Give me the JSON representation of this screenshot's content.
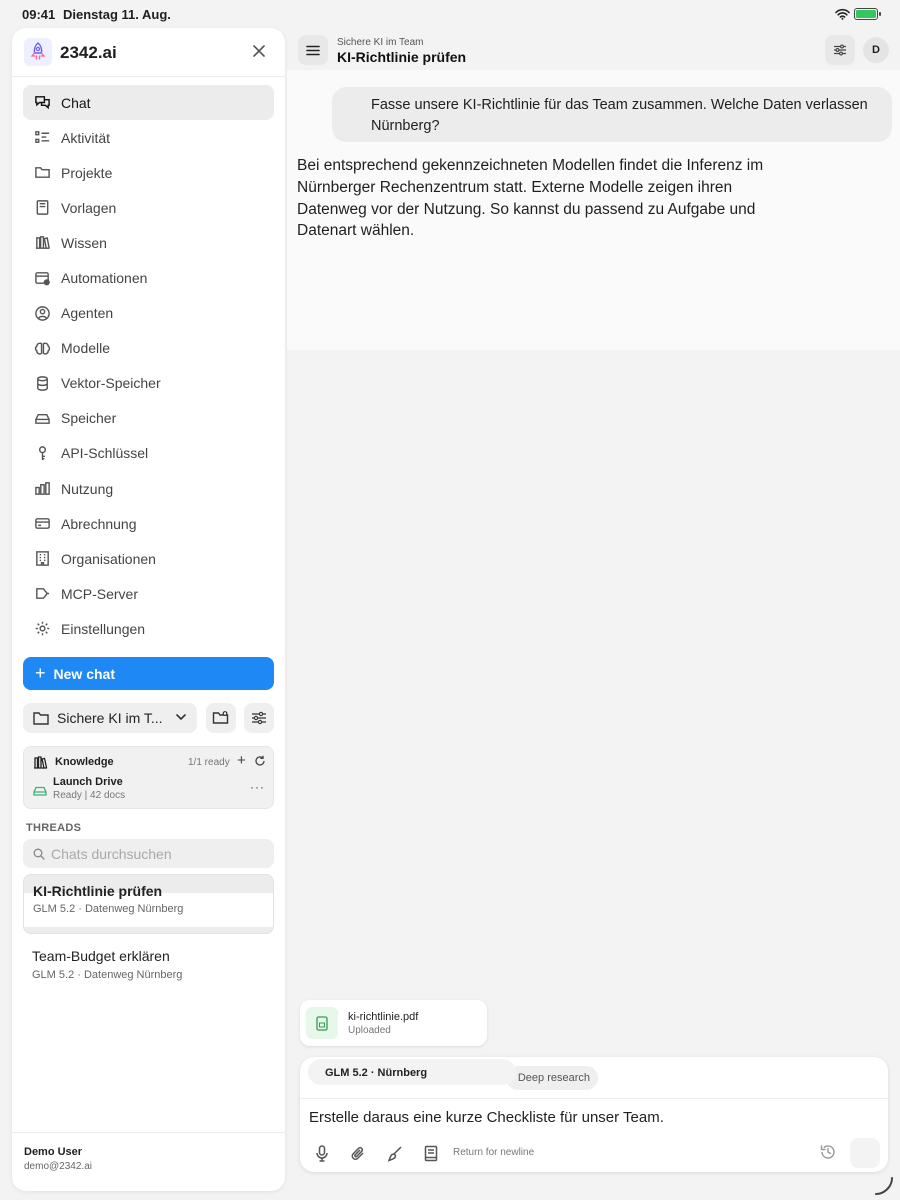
{
  "status_bar": {
    "time": "09:41",
    "date": "Dienstag 11. Aug."
  },
  "sidebar": {
    "brand": "2342.ai",
    "nav": [
      {
        "label": "Chat",
        "icon": "chat-bubbles-icon",
        "active": true
      },
      {
        "label": "Aktivität",
        "icon": "activity-list-icon"
      },
      {
        "label": "Projekte",
        "icon": "folder-icon"
      },
      {
        "label": "Vorlagen",
        "icon": "template-book-icon"
      },
      {
        "label": "Wissen",
        "icon": "library-shelf-icon"
      },
      {
        "label": "Automationen",
        "icon": "automation-calendar-icon"
      },
      {
        "label": "Agenten",
        "icon": "agents-icon"
      },
      {
        "label": "Modelle",
        "icon": "brain-icon"
      },
      {
        "label": "Vektor-Speicher",
        "icon": "database-icon"
      },
      {
        "label": "Speicher",
        "icon": "drive-icon"
      },
      {
        "label": "API-Schlüssel",
        "icon": "key-icon"
      },
      {
        "label": "Nutzung",
        "icon": "usage-bars-icon"
      },
      {
        "label": "Abrechnung",
        "icon": "credit-card-icon"
      },
      {
        "label": "Organisationen",
        "icon": "building-icon"
      },
      {
        "label": "MCP-Server",
        "icon": "plug-icon"
      },
      {
        "label": "Einstellungen",
        "icon": "gear-icon"
      }
    ],
    "new_chat_label": "New chat",
    "project_name": "Sichere KI im T...",
    "knowledge": {
      "title": "Knowledge",
      "ready": "1/1 ready",
      "add": "+",
      "more": "···",
      "drive_name": "Launch Drive",
      "drive_status": "Ready | 42 docs"
    },
    "threads_label": "THREADS",
    "search_placeholder": "Chats durchsuchen",
    "threads": [
      {
        "title": "KI-Richtlinie prüfen",
        "meta": "GLM 5.2 · Datenweg Nürnberg",
        "active": true
      },
      {
        "title": "Team-Budget erklären",
        "meta": "GLM 5.2 · Datenweg Nürnberg",
        "active": false
      }
    ],
    "user": {
      "name": "Demo User",
      "email": "demo@2342.ai"
    }
  },
  "topbar": {
    "breadcrumb": "Sichere KI im Team",
    "title": "KI-Richtlinie prüfen",
    "avatar_initial": "D"
  },
  "chat": {
    "user_message": "Fasse unsere KI-Richtlinie für das Team zusammen. Welche Daten verlassen Nürnberg?",
    "assistant_message": "Bei entsprechend gekennzeichneten Modellen findet die Inferenz im Nürnberger Rechenzentrum statt. Externe Modelle zeigen ihren Datenweg vor der Nutzung. So kannst du passend zu Aufgabe und Datenart wählen."
  },
  "attachment": {
    "name": "ki-richtlinie.pdf",
    "status": "Uploaded"
  },
  "composer": {
    "model": "GLM 5.2 · Nürnberg",
    "deep_research": "Deep research",
    "input_value": "Erstelle daraus eine kurze Checkliste für unser Team.",
    "hint": "Return for newline"
  },
  "colors": {
    "accent": "#1e88f5",
    "sidebar_bg": "#ffffff",
    "app_bg": "#f3f3f3",
    "battery": "#35c759"
  }
}
